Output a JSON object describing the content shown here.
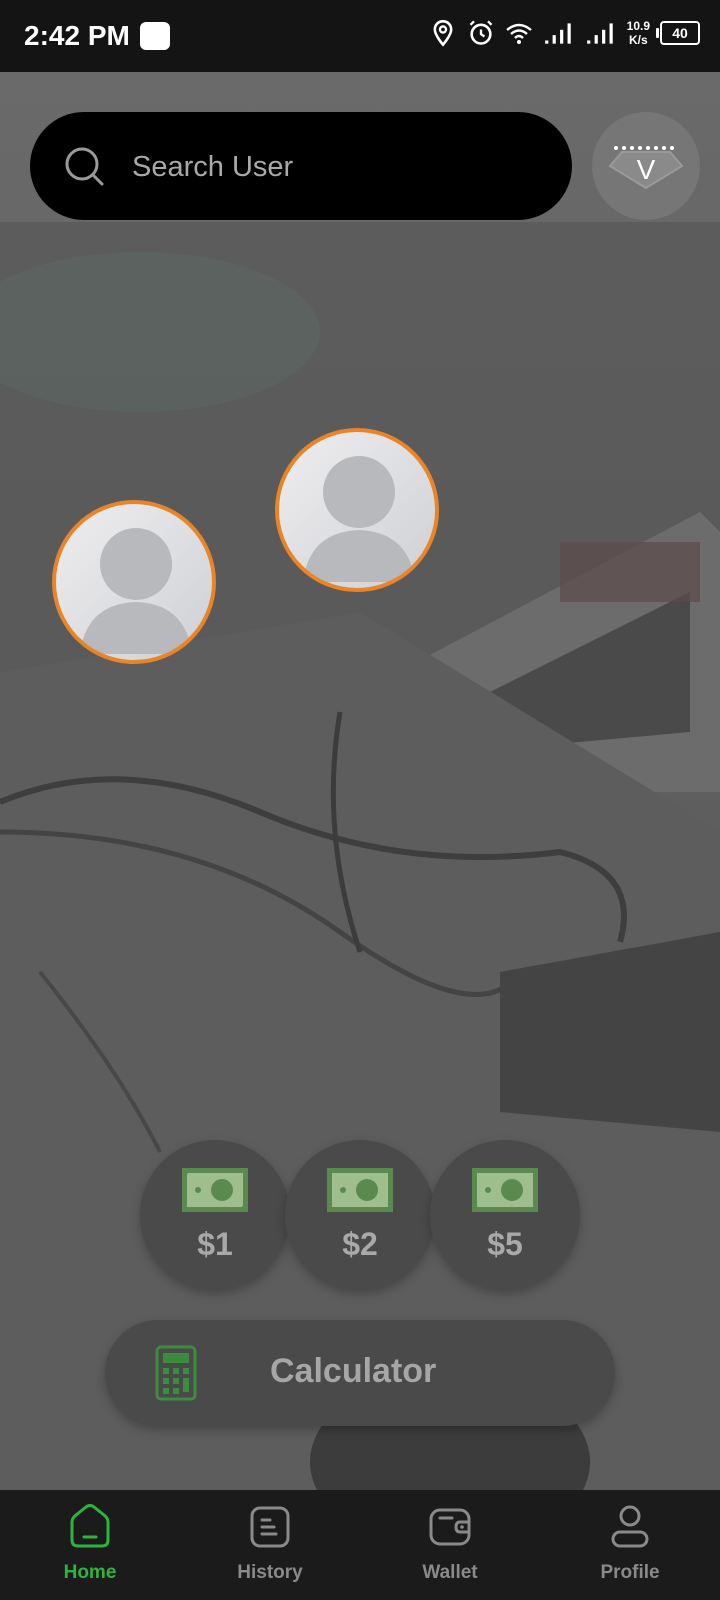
{
  "status_bar": {
    "time": "2:42 PM",
    "speed_value": "10.9",
    "speed_unit": "K/s",
    "battery": "40",
    "icons": [
      "location-icon",
      "alarm-icon",
      "wifi-icon",
      "signal-icon",
      "signal-icon",
      "battery-icon"
    ]
  },
  "search": {
    "placeholder": "Search User",
    "icon": "search-icon"
  },
  "vip": {
    "label": "V",
    "icon": "diamond-badge-icon"
  },
  "avatars": [
    {
      "icon": "user-placeholder-icon"
    },
    {
      "icon": "user-placeholder-icon"
    }
  ],
  "tips": [
    {
      "label": "$1",
      "icon": "cash-icon"
    },
    {
      "label": "$2",
      "icon": "cash-icon"
    },
    {
      "label": "$5",
      "icon": "cash-icon"
    }
  ],
  "calculator": {
    "label": "Calculator",
    "icon": "calculator-icon"
  },
  "nav": {
    "items": [
      {
        "label": "Home",
        "icon": "home-icon",
        "active": true
      },
      {
        "label": "History",
        "icon": "history-icon",
        "active": false
      },
      {
        "label": "Wallet",
        "icon": "wallet-icon",
        "active": false
      },
      {
        "label": "Profile",
        "icon": "profile-icon",
        "active": false
      }
    ]
  },
  "colors": {
    "accent_orange": "#e98427",
    "active_green": "#2db43c",
    "cash_green": "#5b8a4e"
  }
}
